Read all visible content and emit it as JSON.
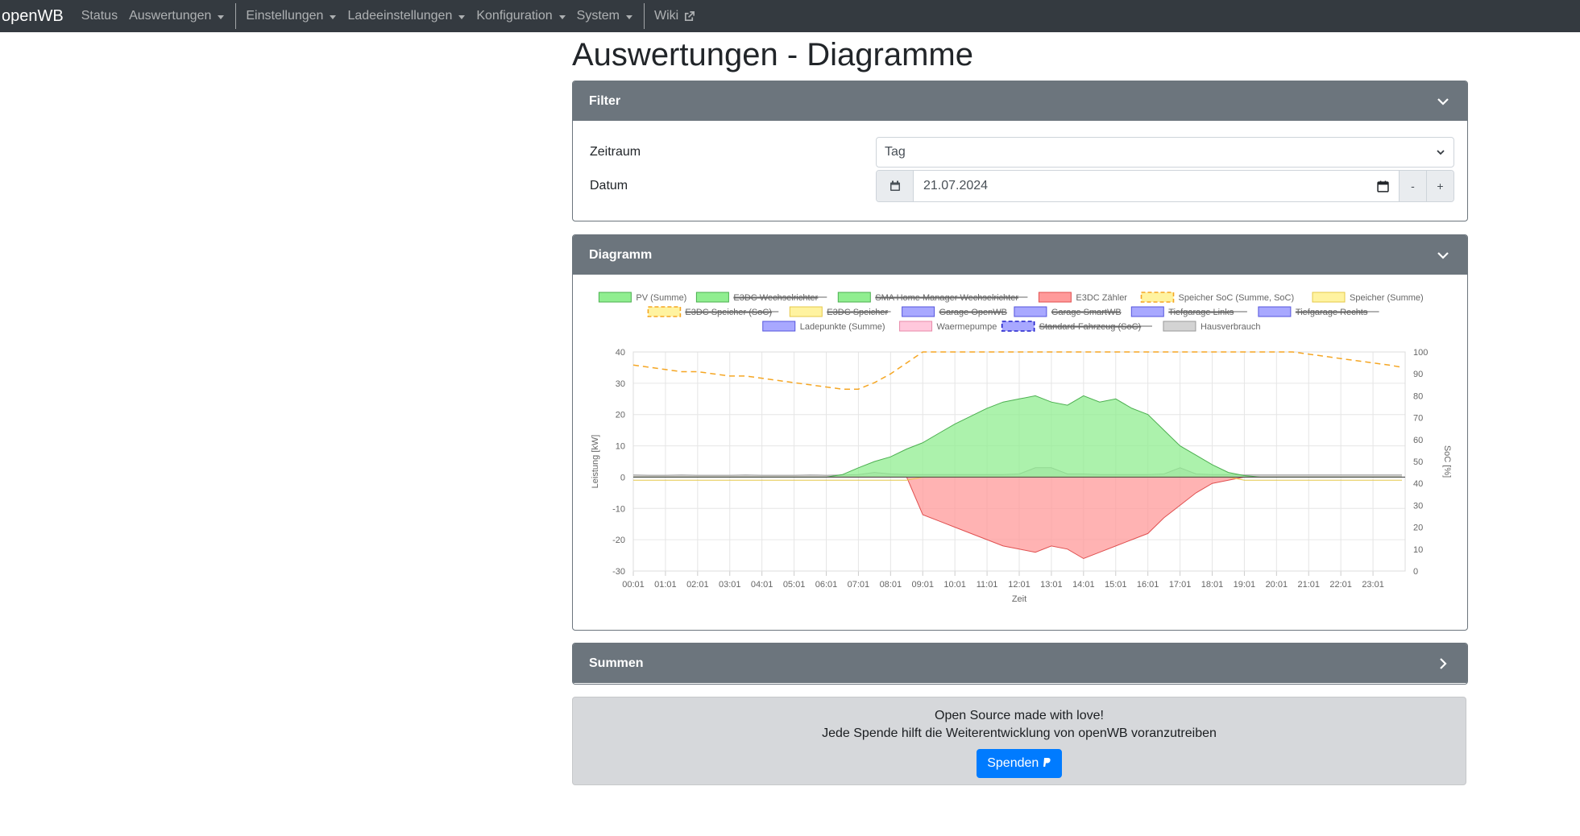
{
  "navbar": {
    "brand": "openWB",
    "items": [
      {
        "label": "Status"
      },
      {
        "label": "Auswertungen"
      },
      {
        "label": "Einstellungen"
      },
      {
        "label": "Ladeeinstellungen"
      },
      {
        "label": "Konfiguration"
      },
      {
        "label": "System"
      },
      {
        "label": "Wiki"
      }
    ]
  },
  "page": {
    "title": "Auswertungen - Diagramme"
  },
  "filter": {
    "header": "Filter",
    "zeitraum_label": "Zeitraum",
    "zeitraum_value": "Tag",
    "datum_label": "Datum",
    "datum_value": "21.07.2024",
    "minus_label": "-",
    "plus_label": "+"
  },
  "diagram": {
    "header": "Diagramm"
  },
  "summen": {
    "header": "Summen"
  },
  "footer": {
    "line1": "Open Source made with love!",
    "line2": "Jede Spende hilft die Weiterentwicklung von openWB voranzutreiben",
    "donate_label": "Spenden"
  },
  "chart_data": {
    "type": "area",
    "xlabel": "Zeit",
    "ylabel_left": "Leistung [kW]",
    "ylabel_right": "SoC [%]",
    "ylim_left": [
      -30,
      40
    ],
    "ylim_right": [
      0,
      100
    ],
    "yticks_left": [
      40,
      30,
      20,
      10,
      0,
      -10,
      -20,
      -30
    ],
    "yticks_right": [
      100,
      90,
      80,
      70,
      60,
      50,
      40,
      30,
      20,
      10,
      0
    ],
    "x_ticks": [
      "00:01",
      "01:01",
      "02:01",
      "03:01",
      "04:01",
      "05:01",
      "06:01",
      "07:01",
      "08:01",
      "09:01",
      "10:01",
      "11:01",
      "12:01",
      "13:01",
      "14:01",
      "15:01",
      "16:01",
      "17:01",
      "18:01",
      "19:01",
      "20:01",
      "21:01",
      "22:01",
      "23:01"
    ],
    "legend_position": "top",
    "legend": [
      {
        "label": "PV (Summe)",
        "fill": "#90ee90",
        "stroke": "#4caf50",
        "hidden": false,
        "dashed": false
      },
      {
        "label": "E3DC Wechselrichter",
        "fill": "#90ee90",
        "stroke": "#4caf50",
        "hidden": true,
        "dashed": false
      },
      {
        "label": "SMA Home Manager Wechselrichter",
        "fill": "#90ee90",
        "stroke": "#4caf50",
        "hidden": true,
        "dashed": false
      },
      {
        "label": "E3DC Zähler",
        "fill": "#ff9a9a",
        "stroke": "#e05050",
        "hidden": false,
        "dashed": false
      },
      {
        "label": "Speicher SoC (Summe, SoC)",
        "fill": "#fff3a0",
        "stroke": "#f5a623",
        "hidden": false,
        "dashed": true
      },
      {
        "label": "Speicher (Summe)",
        "fill": "#fff3a0",
        "stroke": "#e6c84a",
        "hidden": false,
        "dashed": false
      },
      {
        "label": "E3DC Speicher (SoC)",
        "fill": "#fff3a0",
        "stroke": "#f5a623",
        "hidden": true,
        "dashed": true
      },
      {
        "label": "E3DC Speicher",
        "fill": "#fff3a0",
        "stroke": "#e6c84a",
        "hidden": true,
        "dashed": false
      },
      {
        "label": "Garage OpenWB",
        "fill": "#a8a8ff",
        "stroke": "#5555dd",
        "hidden": true,
        "dashed": false
      },
      {
        "label": "Garage SmartWB",
        "fill": "#a8a8ff",
        "stroke": "#5555dd",
        "hidden": true,
        "dashed": false
      },
      {
        "label": "Tiefgarage Links",
        "fill": "#a8a8ff",
        "stroke": "#5555dd",
        "hidden": true,
        "dashed": false
      },
      {
        "label": "Tiefgarage Rechts",
        "fill": "#a8a8ff",
        "stroke": "#5555dd",
        "hidden": true,
        "dashed": false
      },
      {
        "label": "Ladepunkte (Summe)",
        "fill": "#a8a8ff",
        "stroke": "#5555dd",
        "hidden": false,
        "dashed": false
      },
      {
        "label": "Waermepumpe",
        "fill": "#ffc8dc",
        "stroke": "#e88aaa",
        "hidden": false,
        "dashed": false
      },
      {
        "label": "Standard-Fahrzeug (SoC)",
        "fill": "#a8a8ff",
        "stroke": "#2222cc",
        "hidden": true,
        "dashed": true
      },
      {
        "label": "Hausverbrauch",
        "fill": "#d3d3d3",
        "stroke": "#999999",
        "hidden": false,
        "dashed": false
      }
    ],
    "hours": [
      0,
      0.5,
      1,
      1.5,
      2,
      2.5,
      3,
      3.5,
      4,
      4.5,
      5,
      5.5,
      6,
      6.5,
      7,
      7.5,
      8,
      8.5,
      9,
      9.5,
      10,
      10.5,
      11,
      11.5,
      12,
      12.5,
      13,
      13.5,
      14,
      14.5,
      15,
      15.5,
      16,
      16.5,
      17,
      17.5,
      18,
      18.5,
      19,
      19.5,
      20,
      20.5,
      21,
      21.5,
      22,
      22.5,
      23,
      23.5,
      23.9
    ],
    "series": [
      {
        "name": "PV (Summe)",
        "color": "#4caf50",
        "fill": "#90ee90",
        "values": [
          0,
          0,
          0,
          0,
          0,
          0,
          0,
          0,
          0,
          0,
          0,
          0,
          0,
          0.8,
          3,
          5,
          6.5,
          9,
          11,
          14,
          17,
          19.5,
          22,
          24,
          25,
          26,
          24,
          23,
          26,
          24,
          25,
          22,
          20,
          15,
          10,
          7,
          4,
          1.5,
          0.5,
          0,
          0,
          0,
          0,
          0,
          0,
          0,
          0,
          0,
          0
        ]
      },
      {
        "name": "E3DC Zähler",
        "color": "#e05050",
        "fill": "#ff9a9a",
        "values": [
          0,
          0,
          0,
          0,
          0,
          0,
          0,
          0,
          0,
          0,
          0,
          0,
          0,
          0,
          0,
          0,
          0,
          0,
          -12,
          -14,
          -16,
          -18,
          -20,
          -22,
          -23,
          -24,
          -22,
          -23,
          -26,
          -24,
          -22,
          -20,
          -18,
          -13,
          -9,
          -5,
          -2,
          -1,
          0,
          0,
          0,
          0,
          0,
          0,
          0,
          0,
          0,
          0,
          0
        ]
      },
      {
        "name": "Speicher SoC (Summe, SoC)",
        "axis": "right",
        "color": "#f5a623",
        "dashed": true,
        "values": [
          94,
          93,
          92,
          91,
          91,
          90,
          89,
          89,
          88,
          87,
          86,
          85,
          84,
          83,
          83,
          86,
          90,
          95,
          100,
          100,
          100,
          100,
          100,
          100,
          100,
          100,
          100,
          100,
          100,
          100,
          100,
          100,
          100,
          100,
          100,
          100,
          100,
          100,
          100,
          100,
          100,
          100,
          99,
          98,
          97,
          96,
          95,
          94,
          93
        ]
      },
      {
        "name": "Speicher (Summe)",
        "color": "#e6c84a",
        "values": [
          -1,
          -1,
          -1,
          -1,
          -1,
          -1,
          -1,
          -1,
          -1,
          -1,
          -1,
          -1,
          -1,
          -1,
          -1,
          -1,
          -1,
          -1,
          0,
          0,
          0,
          0,
          0,
          0,
          0,
          0,
          0,
          0,
          0,
          0,
          0,
          0,
          0,
          0,
          0,
          0,
          0,
          0,
          -1,
          -1,
          -1,
          -1,
          -1,
          -1,
          -1,
          -1,
          -1,
          -1,
          -1
        ]
      },
      {
        "name": "Hausverbrauch",
        "color": "#999999",
        "fill": "#d3d3d3",
        "values": [
          0.7,
          0.6,
          0.6,
          0.7,
          0.6,
          0.6,
          0.6,
          0.7,
          0.6,
          0.6,
          0.6,
          0.7,
          0.6,
          0.7,
          0.8,
          1.5,
          1,
          0.8,
          0.8,
          0.8,
          0.8,
          0.8,
          0.8,
          0.8,
          1,
          3,
          3,
          1,
          1,
          0.8,
          0.8,
          0.8,
          0.8,
          1,
          3,
          1,
          0.8,
          0.8,
          0.7,
          0.7,
          0.7,
          0.7,
          0.7,
          0.7,
          0.7,
          0.7,
          0.7,
          0.7,
          0.7
        ]
      }
    ]
  }
}
